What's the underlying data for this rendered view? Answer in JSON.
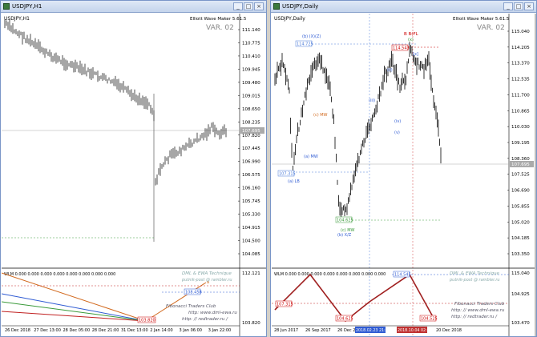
{
  "left_window": {
    "title": "USDJPY,H1",
    "chart_label": "USDJPY,H1",
    "indicator_name": "Elliott Wave Maker 5.61.5",
    "version": "VAR. 02",
    "price_labels": [
      "111.140",
      "110.775",
      "110.410",
      "109.945",
      "109.480",
      "109.015",
      "108.650",
      "108.235",
      "107.820",
      "107.445",
      "106.990",
      "106.575",
      "106.160",
      "105.745",
      "105.330",
      "104.915",
      "104.500",
      "104.085"
    ],
    "current_price": "107.695",
    "sub_price_labels": [
      "112.121",
      "103.820"
    ],
    "sub_label": "WLM 0.000 0.000 0.000 0.000 0.000 0.000 0.000 0.000",
    "sub_values": [
      "108.458",
      "103.820"
    ],
    "sub_marker": "a",
    "credit_1": "DML & EWA Technique",
    "credit_2": "putnik-post @ rambler.ru",
    "credit_3": "Fibonacci Traders Club",
    "credit_4": "http: www.dml-ewa.ru",
    "credit_5": "http: // redtrader.ru /",
    "date_labels": [
      "26 Dec 2018",
      "27 Dec 13:00",
      "28 Dec 05:00",
      "28 Dec 21:00",
      "31 Dec 13:00",
      "2 Jan 14:00",
      "3 Jan 06:00",
      "3 Jan 22:00"
    ]
  },
  "right_window": {
    "title": "USDJPY,Daily",
    "chart_label": "USDJPY,Daily",
    "indicator_name": "Elliott Wave Maker 5.61.5",
    "version": "VAR. 02",
    "price_labels": [
      "115.040",
      "114.205",
      "113.370",
      "112.535",
      "111.700",
      "110.865",
      "110.030",
      "109.195",
      "108.360",
      "107.525",
      "106.690",
      "105.855",
      "105.020",
      "104.185",
      "103.350"
    ],
    "current_price": "107.695",
    "sub_price_labels": [
      "115.040",
      "104.925",
      "103.470"
    ],
    "sub_label": "WLM 0.000 0.000 0.000 0.000 0.000 0.000 0.000 0.000",
    "sub_values": [
      "114.545",
      "107.315",
      "104.625",
      "104.525"
    ],
    "credit_1": "DML & EWA Technique",
    "credit_2": "putnik-post @ rambler.ru",
    "credit_3": "Fibonacci Traders Club",
    "credit_4": "http: // www.dml-ewa.ru",
    "credit_5": "http: // redtrader.ru /",
    "date_labels": [
      "28 Jun 2017",
      "26 Sep 2017",
      "26 Dec 2017",
      "20 Dec 2018"
    ],
    "date_highlight": "2018.02.23 21:00",
    "date_highlight_2": "2018.10.04 02:00",
    "wave_labels": [
      "(b) (X)(Z)",
      "(c) MW",
      "(b) X/Z",
      "(c) MW",
      "(a) LB",
      "(a) MW",
      "B B(FL",
      "(x)",
      "[x]",
      "(ii)",
      "(iii)",
      "(iv)",
      "(v)"
    ],
    "level_labels": [
      "114.725",
      "107.315",
      "114.543",
      "104.625"
    ]
  }
}
